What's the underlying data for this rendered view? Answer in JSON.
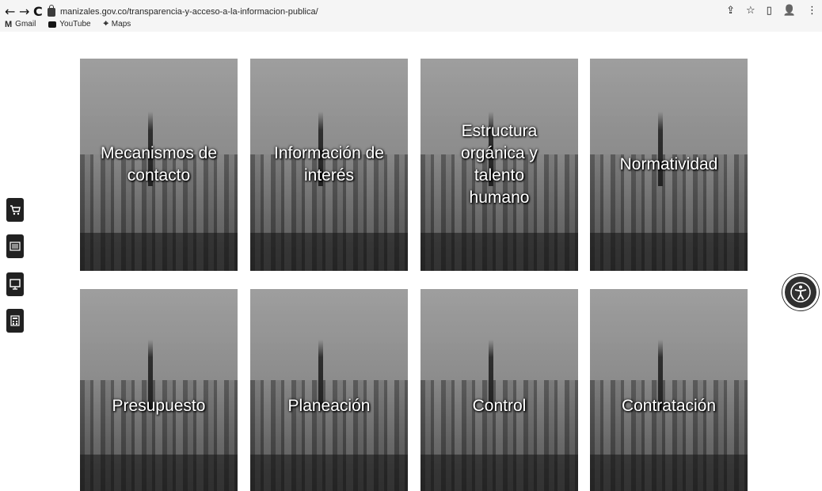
{
  "browser": {
    "back": "←",
    "forward": "→",
    "reload": "C",
    "url": "manizales.gov.co/transparencia-y-acceso-a-la-informacion-publica/",
    "bookmarks": [
      {
        "icon": "M",
        "label": "Gmail"
      },
      {
        "icon": "youtube-icon",
        "label": "YouTube"
      },
      {
        "icon": "maps-icon",
        "label": "Maps"
      }
    ]
  },
  "cards": [
    {
      "label": "Mecanismos de contacto"
    },
    {
      "label": "Información de interés"
    },
    {
      "label": "Estructura orgánica y talento humano"
    },
    {
      "label": "Normatividad"
    },
    {
      "label": "Presupuesto"
    },
    {
      "label": "Planeación"
    },
    {
      "label": "Control"
    },
    {
      "label": "Contratación"
    }
  ],
  "side_tools": [
    "cart-icon",
    "newspaper-icon",
    "monitor-icon",
    "calculator-icon"
  ],
  "accessibility_icon": "accessibility-icon"
}
